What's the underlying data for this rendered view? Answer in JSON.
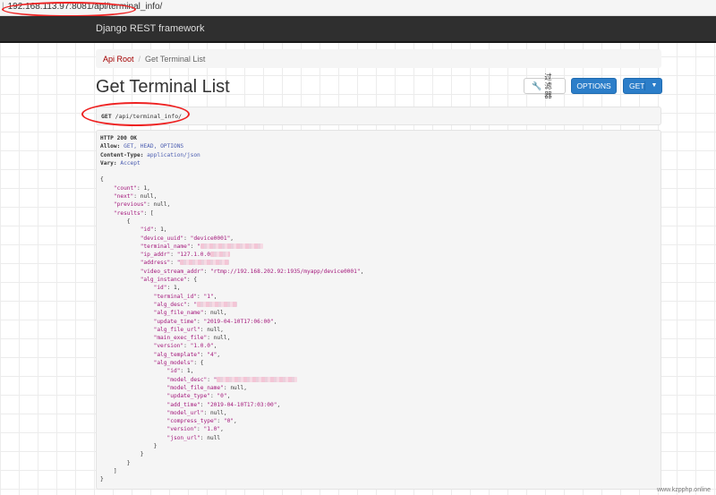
{
  "browser": {
    "url": "192.168.113.97:8081/api/terminal_info/"
  },
  "navbar": {
    "brand": "Django REST framework"
  },
  "breadcrumb": {
    "root": "Api Root",
    "current": "Get Terminal List"
  },
  "page": {
    "title": "Get Terminal List"
  },
  "toolbar": {
    "filter_label": "过滤器",
    "options_label": "OPTIONS",
    "get_label": "GET"
  },
  "request": {
    "method": "GET",
    "path": "/api/terminal_info/"
  },
  "response": {
    "status": "HTTP 200 OK",
    "headers": [
      {
        "key": "Allow:",
        "value": "GET, HEAD, OPTIONS"
      },
      {
        "key": "Content-Type:",
        "value": "application/json"
      },
      {
        "key": "Vary:",
        "value": "Accept"
      }
    ],
    "count": "1",
    "next": "null",
    "previous": "null",
    "result": {
      "id": "1",
      "device_uuid": "\"device0001\"",
      "terminal_name": "\"",
      "ip_addr": "\"127.1.0.0",
      "address": "\"",
      "video_stream_addr": "\"rtmp://192.168.202.92:1935/myapp/device0001\"",
      "alg_instance": {
        "id": "1",
        "terminal_id": "\"1\"",
        "alg_desc": "\"",
        "alg_file_name": "null",
        "update_time": "\"2019-04-10T17:06:00\"",
        "alg_file_url": "null",
        "main_exec_file": "null",
        "version": "\"1.0.0\"",
        "alg_template": "\"4\"",
        "alg_models": {
          "id": "1",
          "model_desc": "\"",
          "model_file_name": "null",
          "update_type": "\"0\"",
          "add_time": "\"2019-04-10T17:03:00\"",
          "model_url": "null",
          "compress_type": "\"0\"",
          "version": "\"1.0\"",
          "json_url": "null"
        }
      }
    }
  },
  "watermark": "www.kzpphp.online"
}
